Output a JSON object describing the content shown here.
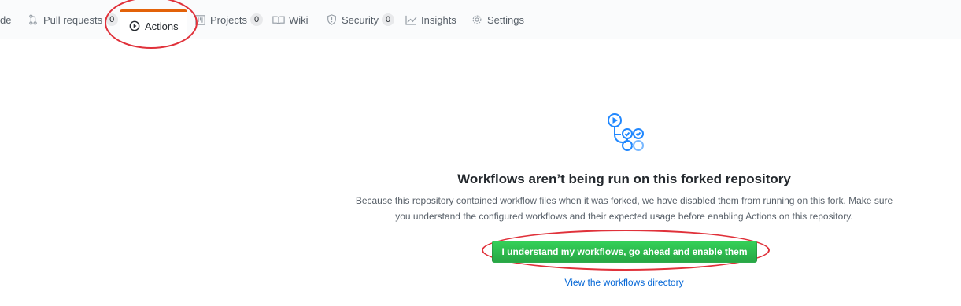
{
  "nav": {
    "items": [
      {
        "label": "de",
        "icon": "code-icon"
      },
      {
        "label": "Pull requests",
        "icon": "pull-request-icon",
        "counter": "0"
      },
      {
        "label": "Actions",
        "icon": "play-circle-icon",
        "selected": true
      },
      {
        "label": "Projects",
        "icon": "project-board-icon",
        "counter": "0"
      },
      {
        "label": "Wiki",
        "icon": "book-icon"
      },
      {
        "label": "Security",
        "icon": "shield-icon",
        "counter": "0"
      },
      {
        "label": "Insights",
        "icon": "graph-icon"
      },
      {
        "label": "Settings",
        "icon": "gear-icon"
      }
    ],
    "selected_accent": "#e36209"
  },
  "blankslate": {
    "icon": "workflow-icon",
    "title": "Workflows aren’t being run on this forked repository",
    "description_line1": "Because this repository contained workflow files when it was forked, we have disabled them from running on this fork. Make sure",
    "description_line2": "you understand the configured workflows and their expected usage before enabling Actions on this repository.",
    "enable_button": "I understand my workflows, go ahead and enable them",
    "view_link": "View the workflows directory"
  },
  "annotations": {
    "color": "#e0313a"
  },
  "colors": {
    "button_green": "#2ea44f",
    "link_blue": "#0366d6",
    "icon_blue": "#2188ff"
  }
}
